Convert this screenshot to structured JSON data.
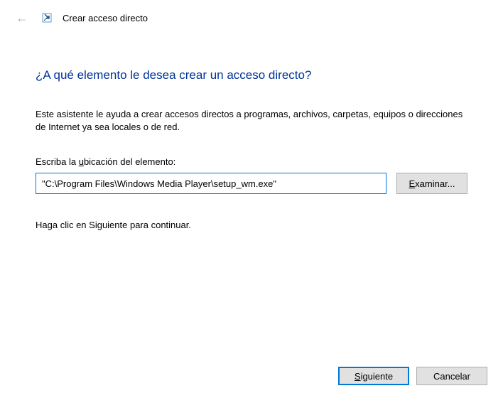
{
  "header": {
    "title": "Crear acceso directo"
  },
  "main": {
    "heading": "¿A qué elemento le desea crear un acceso directo?",
    "description": "Este asistente le ayuda a crear accesos directos a programas, archivos, carpetas, equipos o direcciones de Internet ya sea locales o de red.",
    "input_label_prefix": "Escriba la ",
    "input_label_underline": "u",
    "input_label_suffix": "bicación del elemento:",
    "path_value": "\"C:\\Program Files\\Windows Media Player\\setup_wm.exe\"",
    "browse_underline": "E",
    "browse_suffix": "xaminar...",
    "continue_text": "Haga clic en Siguiente para continuar."
  },
  "footer": {
    "next_underline": "S",
    "next_suffix": "iguiente",
    "cancel_label": "Cancelar"
  }
}
